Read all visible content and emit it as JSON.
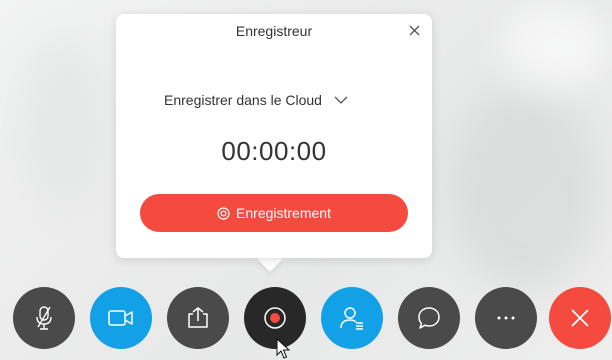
{
  "popup": {
    "title": "Enregistreur",
    "destination": "Enregistrer dans le Cloud",
    "timer": "00:00:00",
    "record_label": "Enregistrement"
  },
  "icons": {
    "close": "close-icon",
    "dropdown": "chevron-down-icon",
    "record_target": "target-icon"
  },
  "toolbar": {
    "buttons": [
      {
        "name": "mute-button",
        "icon": "microphone-muted-icon"
      },
      {
        "name": "video-button",
        "icon": "video-camera-icon"
      },
      {
        "name": "share-button",
        "icon": "share-icon"
      },
      {
        "name": "record-button",
        "icon": "record-icon"
      },
      {
        "name": "participants-button",
        "icon": "participants-icon"
      },
      {
        "name": "chat-button",
        "icon": "chat-icon"
      },
      {
        "name": "more-button",
        "icon": "more-icon"
      },
      {
        "name": "leave-button",
        "icon": "close-icon"
      }
    ]
  },
  "colors": {
    "accent_red": "#f44a40",
    "accent_blue": "#12a0e6",
    "button_dark": "#4a4a4a",
    "button_black": "#282828"
  }
}
